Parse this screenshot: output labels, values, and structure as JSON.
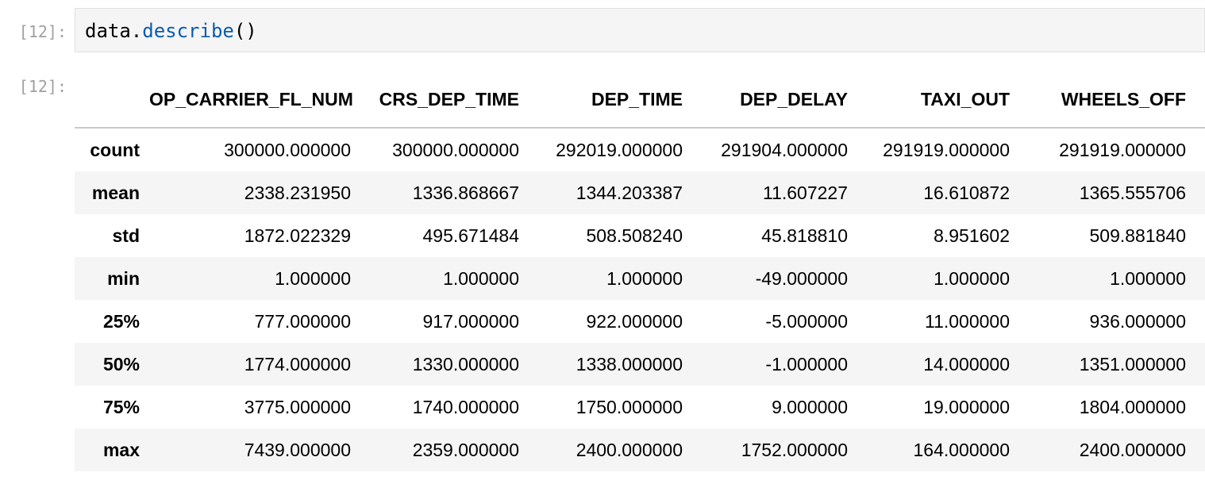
{
  "input_prompt": "[12]:",
  "output_prompt": "[12]:",
  "code": {
    "object": "data",
    "dot": ".",
    "method": "describe",
    "call": "()"
  },
  "table": {
    "columns": [
      "OP_CARRIER_FL_NUM",
      "CRS_DEP_TIME",
      "DEP_TIME",
      "DEP_DELAY",
      "TAXI_OUT",
      "WHEELS_OFF"
    ],
    "rows": [
      {
        "label": "count",
        "values": [
          "300000.000000",
          "300000.000000",
          "292019.000000",
          "291904.000000",
          "291919.000000",
          "291919.000000"
        ]
      },
      {
        "label": "mean",
        "values": [
          "2338.231950",
          "1336.868667",
          "1344.203387",
          "11.607227",
          "16.610872",
          "1365.555706"
        ]
      },
      {
        "label": "std",
        "values": [
          "1872.022329",
          "495.671484",
          "508.508240",
          "45.818810",
          "8.951602",
          "509.881840"
        ]
      },
      {
        "label": "min",
        "values": [
          "1.000000",
          "1.000000",
          "1.000000",
          "-49.000000",
          "1.000000",
          "1.000000"
        ]
      },
      {
        "label": "25%",
        "values": [
          "777.000000",
          "917.000000",
          "922.000000",
          "-5.000000",
          "11.000000",
          "936.000000"
        ]
      },
      {
        "label": "50%",
        "values": [
          "1774.000000",
          "1330.000000",
          "1338.000000",
          "-1.000000",
          "14.000000",
          "1351.000000"
        ]
      },
      {
        "label": "75%",
        "values": [
          "3775.000000",
          "1740.000000",
          "1750.000000",
          "9.000000",
          "19.000000",
          "1804.000000"
        ]
      },
      {
        "label": "max",
        "values": [
          "7439.000000",
          "2359.000000",
          "2400.000000",
          "1752.000000",
          "164.000000",
          "2400.000000"
        ]
      }
    ]
  }
}
